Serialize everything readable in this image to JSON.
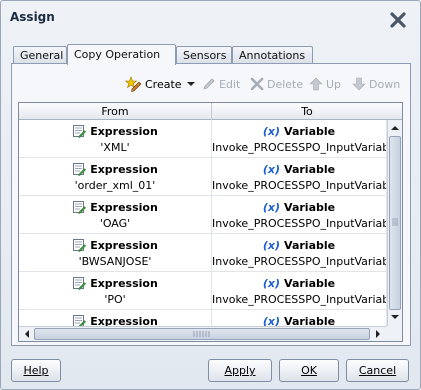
{
  "window": {
    "title": "Assign"
  },
  "tabs": [
    {
      "label": "General",
      "active": false
    },
    {
      "label": "Copy Operation",
      "active": true
    },
    {
      "label": "Sensors",
      "active": false
    },
    {
      "label": "Annotations",
      "active": false
    }
  ],
  "toolbar": {
    "create": "Create",
    "edit": "Edit",
    "delete": "Delete",
    "up": "Up",
    "down": "Down"
  },
  "table": {
    "columns": [
      "From",
      "To"
    ],
    "rows": [
      {
        "from_type": "Expression",
        "from_value": "'XML'",
        "to_type": "Variable",
        "to_value": "Invoke_PROCESSPO_InputVariable"
      },
      {
        "from_type": "Expression",
        "from_value": "'order_xml_01'",
        "to_type": "Variable",
        "to_value": "Invoke_PROCESSPO_InputVariable"
      },
      {
        "from_type": "Expression",
        "from_value": "'OAG'",
        "to_type": "Variable",
        "to_value": "Invoke_PROCESSPO_InputVariable"
      },
      {
        "from_type": "Expression",
        "from_value": "'BWSANJOSE'",
        "to_type": "Variable",
        "to_value": "Invoke_PROCESSPO_InputVariable"
      },
      {
        "from_type": "Expression",
        "from_value": "'PO'",
        "to_type": "Variable",
        "to_value": "Invoke_PROCESSPO_InputVariable"
      },
      {
        "from_type": "Expression",
        "from_value": "",
        "to_type": "Variable",
        "to_value": ""
      }
    ]
  },
  "buttons": {
    "help": "Help",
    "apply": "Apply",
    "ok": "OK",
    "cancel": "Cancel"
  },
  "icons": {
    "variable_glyph": "(x)"
  },
  "colors": {
    "variable_accent": "#1d5fd0",
    "create_accent": "#2b7a2b"
  }
}
